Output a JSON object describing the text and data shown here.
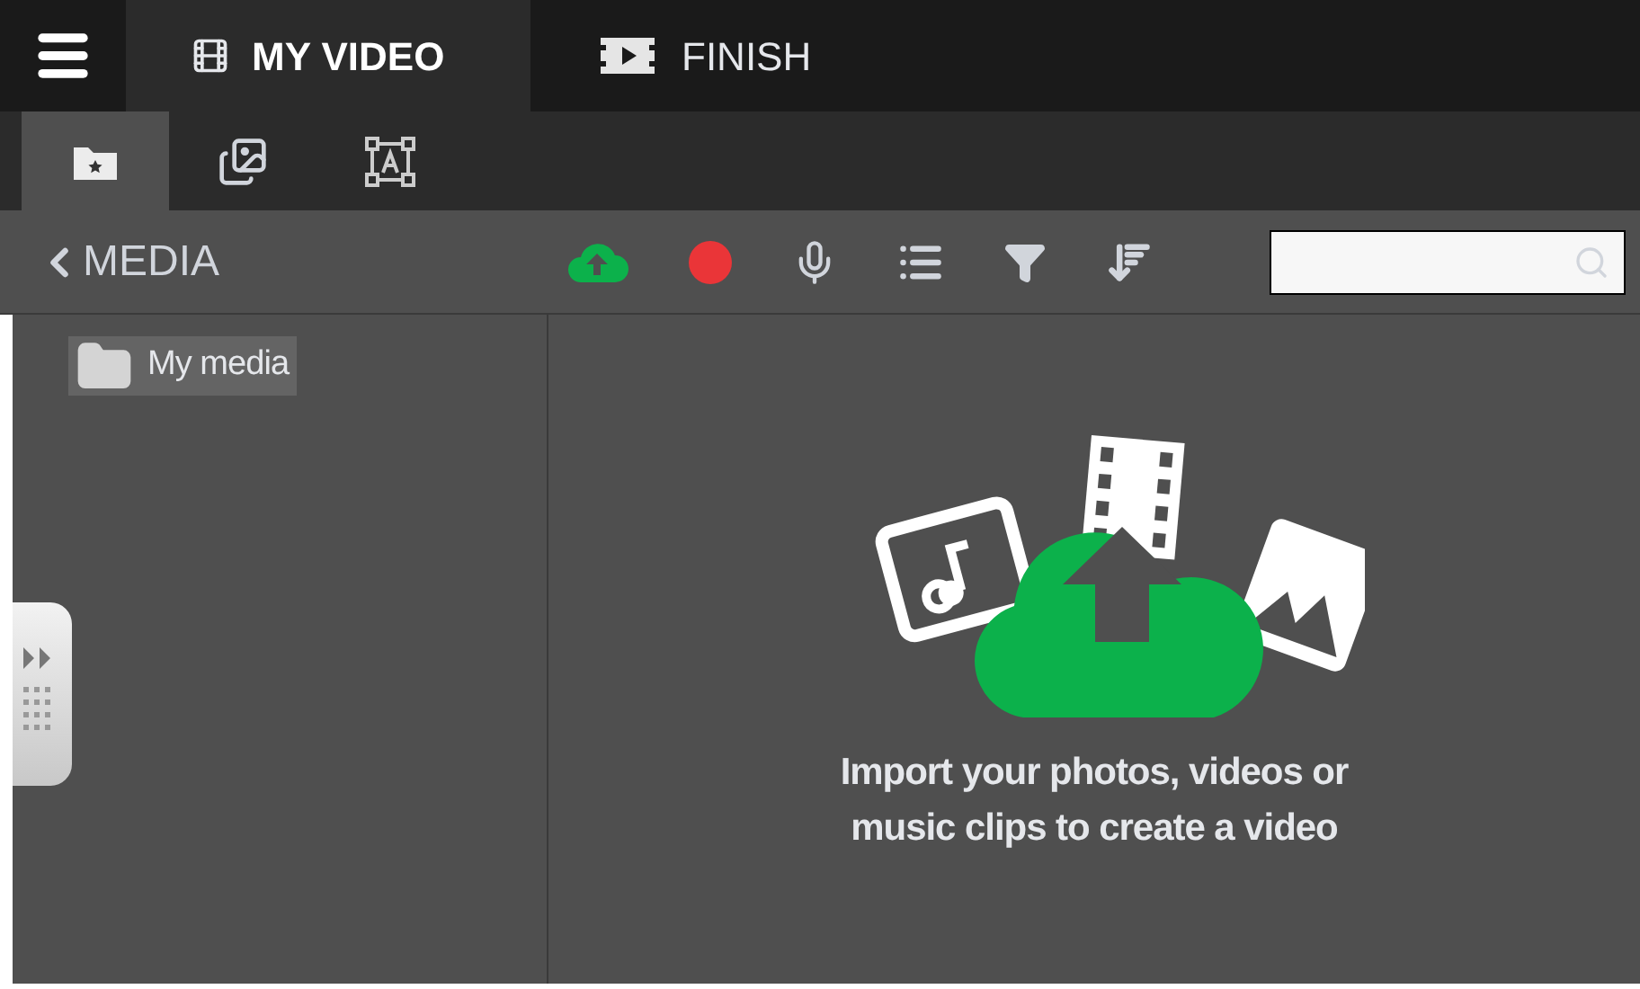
{
  "main_tabs": [
    {
      "kind": "film",
      "label": "MY VIDEO",
      "selected": true
    },
    {
      "kind": "finish",
      "label": "FINISH",
      "selected": false
    }
  ],
  "sub_tabs": [
    {
      "kind": "folder",
      "selected": true
    },
    {
      "kind": "images",
      "selected": false
    },
    {
      "kind": "text",
      "selected": false
    }
  ],
  "toolbar": {
    "title": "MEDIA",
    "tools": [
      {
        "kind": "upload"
      },
      {
        "kind": "record"
      },
      {
        "kind": "mic"
      },
      {
        "kind": "list"
      },
      {
        "kind": "filter"
      },
      {
        "kind": "sort"
      }
    ]
  },
  "folders": [
    {
      "label": "My media",
      "selected": true
    }
  ],
  "empty_state": {
    "line_1": "Import your photos, videos or",
    "line_2": "music clips to create a video"
  }
}
